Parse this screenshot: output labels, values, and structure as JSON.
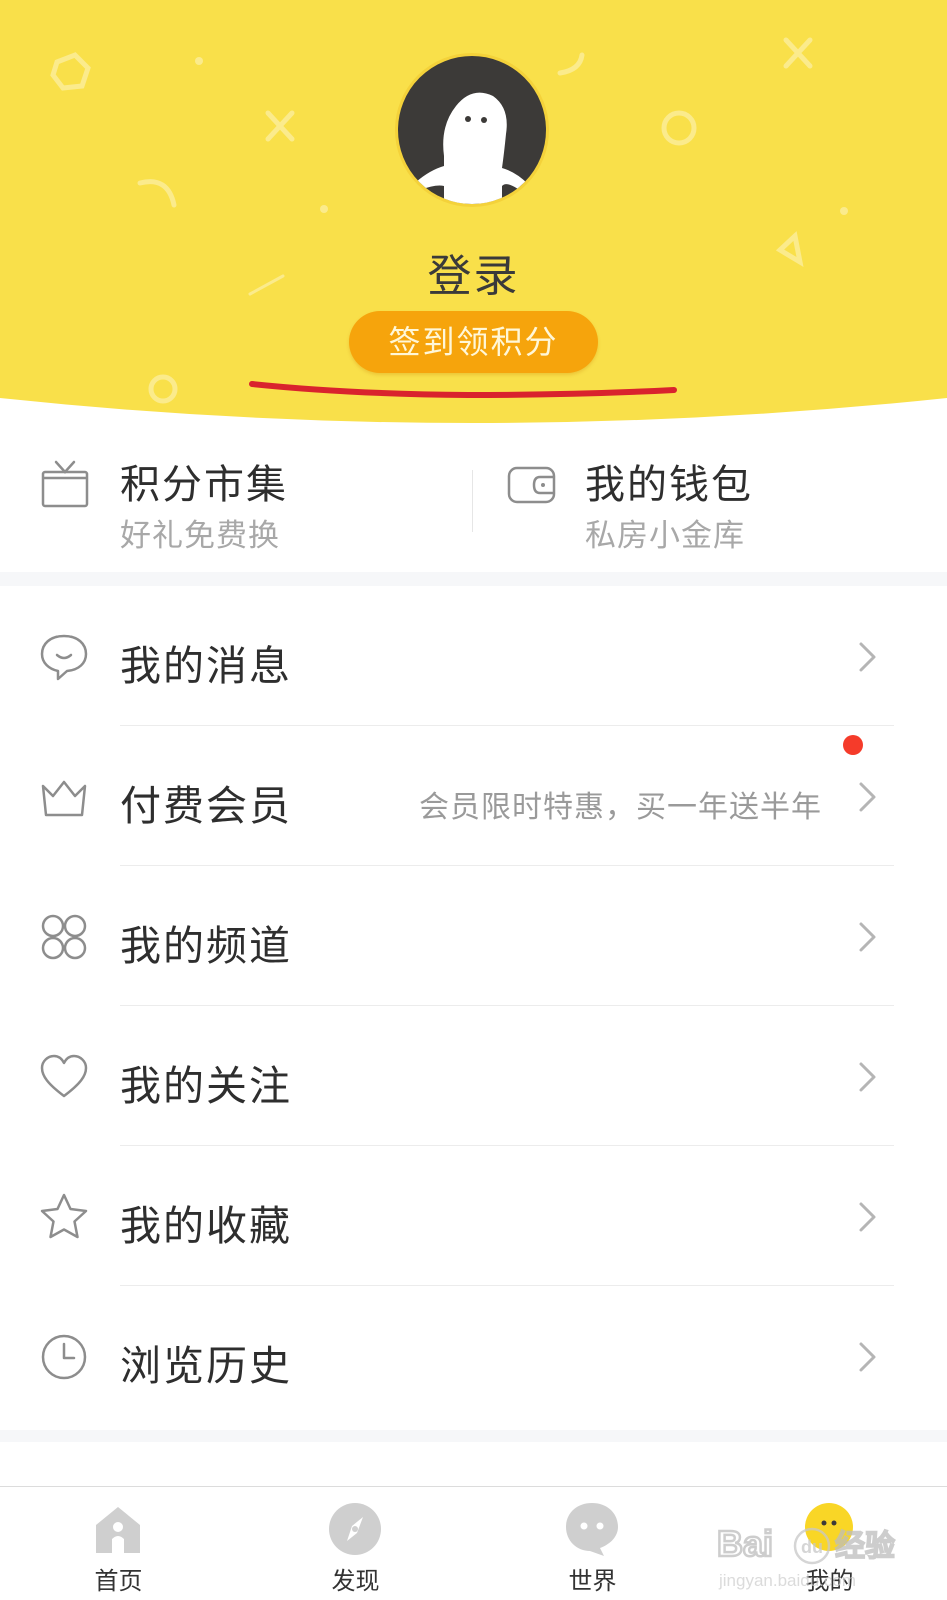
{
  "header": {
    "login_label": "登录",
    "checkin_button": "签到领积分",
    "accent_color": "#f9e04a",
    "button_color": "#f6a40c"
  },
  "tiles": [
    {
      "title": "积分市集",
      "subtitle": "好礼免费换",
      "icon": "gift-box-icon"
    },
    {
      "title": "我的钱包",
      "subtitle": "私房小金库",
      "icon": "wallet-icon"
    }
  ],
  "menu": [
    {
      "label": "我的消息",
      "hint": "",
      "icon": "chat-bubble-icon"
    },
    {
      "label": "付费会员",
      "hint": "会员限时特惠，买一年送半年",
      "icon": "crown-icon",
      "badge_dot": true
    },
    {
      "label": "我的频道",
      "hint": "",
      "icon": "grid-icon"
    },
    {
      "label": "我的关注",
      "hint": "",
      "icon": "heart-icon"
    },
    {
      "label": "我的收藏",
      "hint": "",
      "icon": "star-icon"
    },
    {
      "label": "浏览历史",
      "hint": "",
      "icon": "clock-icon"
    }
  ],
  "tabbar": [
    {
      "label": "首页",
      "icon": "home-icon",
      "active": false
    },
    {
      "label": "发现",
      "icon": "compass-icon",
      "active": false
    },
    {
      "label": "世界",
      "icon": "chat-face-icon",
      "active": false
    },
    {
      "label": "我的",
      "icon": "profile-icon",
      "active": true
    }
  ],
  "watermark": {
    "brand": "Baidu经验",
    "url": "jingyan.baidu.com"
  }
}
